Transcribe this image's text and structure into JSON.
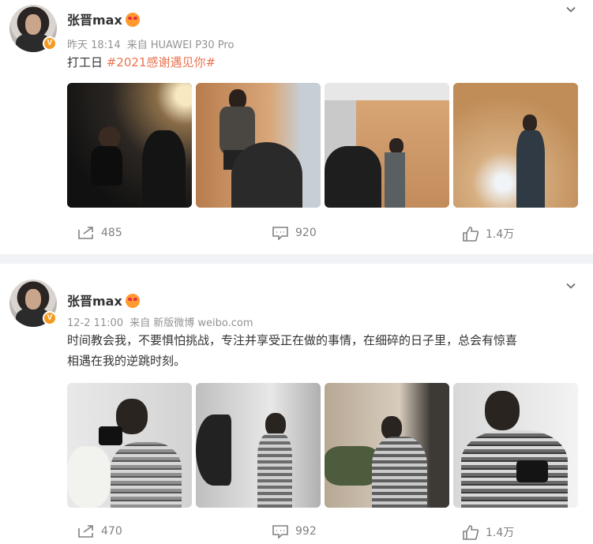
{
  "posts": [
    {
      "author": "张晋max",
      "time": "昨天 18:14",
      "source_prefix": "来自",
      "source": "HUAWEI P30 Pro",
      "text_plain": "打工日 ",
      "text_tag": "#2021感谢遇见你#",
      "photos": [
        "studio-photo-1",
        "studio-photo-2",
        "studio-photo-3",
        "studio-photo-4"
      ],
      "stats": {
        "reposts": "485",
        "comments": "920",
        "likes": "1.4万"
      }
    },
    {
      "author": "张晋max",
      "time": "12-2 11:00",
      "source_prefix": "来自",
      "source": "新版微博 weibo.com",
      "text_line1": "时间教会我，不要惧怕挑战，专注并享受正在做的事情，在细碎的日子里，总会有惊喜",
      "text_line2": "相遇在我的逆跳时刻。",
      "photos": [
        "camera-photo-1",
        "camera-photo-2",
        "camera-photo-3",
        "camera-photo-4"
      ],
      "stats": {
        "reposts": "470",
        "comments": "992",
        "likes": "1.4万"
      }
    }
  ],
  "badge_letter": "V",
  "colors": {
    "accent": "#eb7350",
    "verified": "#f59a21",
    "muted": "#939393"
  }
}
